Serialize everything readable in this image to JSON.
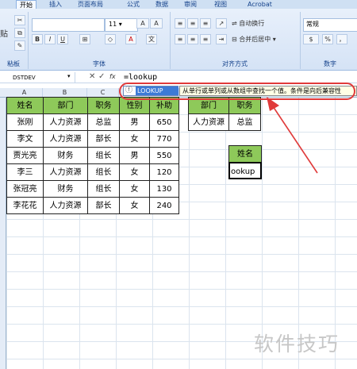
{
  "ribbon": {
    "tabs": [
      "开始",
      "插入",
      "页面布局",
      "公式",
      "数据",
      "审阅",
      "视图",
      "Acrobat"
    ],
    "clipboard_partial": "贴",
    "clipboard_group_label": "粘板",
    "font_size": "11",
    "font_group_label": "字体",
    "align_group_label": "对齐方式",
    "wrap_text": "自动换行",
    "merge_center": "合并后居中",
    "number_format": "常规",
    "number_group_label": "数字",
    "percent": "%",
    "comma": "，"
  },
  "formula_bar": {
    "name_box": "DSTDEV",
    "fx_label": "fx",
    "formula": "=lookup"
  },
  "autocomplete": {
    "item": "LOOKUP",
    "tooltip": "从单行或单列或从数组中查找一个值。条件是向后兼容性"
  },
  "columns": [
    "A",
    "B",
    "C"
  ],
  "table1": {
    "headers": [
      "姓名",
      "部门",
      "职务",
      "性别",
      "补助"
    ],
    "rows": [
      [
        "张刚",
        "人力资源",
        "总监",
        "男",
        "650"
      ],
      [
        "李文",
        "人力资源",
        "部长",
        "女",
        "770"
      ],
      [
        "贾光亮",
        "财务",
        "组长",
        "男",
        "550"
      ],
      [
        "李三",
        "人力资源",
        "组长",
        "女",
        "120"
      ],
      [
        "张冠亮",
        "财务",
        "组长",
        "女",
        "130"
      ],
      [
        "李花花",
        "人力资源",
        "部长",
        "女",
        "240"
      ]
    ]
  },
  "table2": {
    "headers": [
      "部门",
      "职务"
    ],
    "row": [
      "人力资源",
      "总监"
    ]
  },
  "lookup_box": {
    "header": "姓名",
    "value": "ookup"
  },
  "watermark": "软件技巧",
  "colors": {
    "header_green": "#8ec95a",
    "annotation_red": "#e03a3a",
    "autocomplete_blue": "#3d7ad6"
  }
}
